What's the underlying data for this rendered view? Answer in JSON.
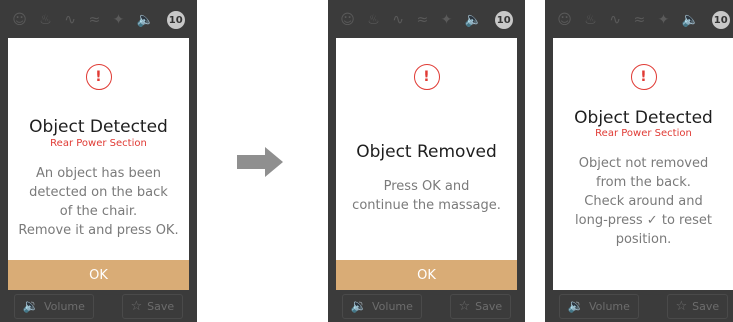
{
  "status_icons": [
    "person-icon",
    "massage-icon",
    "legs-icon",
    "heat-icon",
    "bluetooth-icon",
    "speaker-icon",
    "timer-badge"
  ],
  "timer_value": "10",
  "colors": {
    "accent_red": "#e03a34",
    "ok_gold": "#d9ac76",
    "device_bg": "#3b3b3b"
  },
  "screens": [
    {
      "title": "Object Detected",
      "subtitle": "Rear Power Section",
      "body_lines": [
        "An object has been",
        "detected on the back",
        "of the chair.",
        "Remove it and press OK."
      ],
      "ok_label": "OK",
      "volume_label": "Volume",
      "save_label": "Save"
    },
    {
      "title": "Object Removed",
      "body_lines": [
        "Press OK and",
        "continue the massage."
      ],
      "ok_label": "OK",
      "volume_label": "Volume",
      "save_label": "Save"
    },
    {
      "title": "Object Detected",
      "subtitle": "Rear Power Section",
      "body_lines": [
        "Object not removed",
        "from the back.",
        "Check around and",
        "long-press",
        "to reset",
        "position."
      ],
      "volume_label": "Volume",
      "save_label": "Save"
    }
  ]
}
